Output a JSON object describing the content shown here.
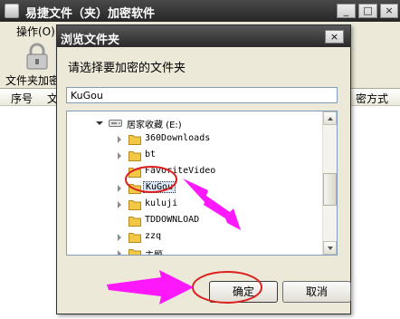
{
  "app": {
    "title": "易捷文件（夹）加密软件",
    "menu_label": "操作(O)",
    "toolbar_label": "文件夹加密",
    "columns": [
      "序号",
      "文",
      "密方式"
    ],
    "window_buttons": [
      "_",
      "□",
      "×"
    ]
  },
  "dialog": {
    "title": "浏览文件夹",
    "close_symbol": "×",
    "prompt": "请选择要加密的文件夹",
    "path_value": "KuGou",
    "tree": {
      "drive_label": "居家收藏 (E:)",
      "folders": [
        "360Downloads",
        "bt",
        "FavoriteVideo",
        "KuGou",
        "kuluji",
        "TDDOWNLOAD",
        "zzq",
        "主题"
      ],
      "selected": "KuGou"
    },
    "ok_label": "确定",
    "cancel_label": "取消"
  },
  "colors": {
    "annotation": "#ff00ff",
    "highlight_ring": "#dd1f1f",
    "titlebar": "#2f2f2f",
    "dialog_bg": "#ece9d8"
  },
  "icons": {
    "toolbar": "lock-icon",
    "drive": "drive-icon",
    "folder": "folder-icon"
  }
}
